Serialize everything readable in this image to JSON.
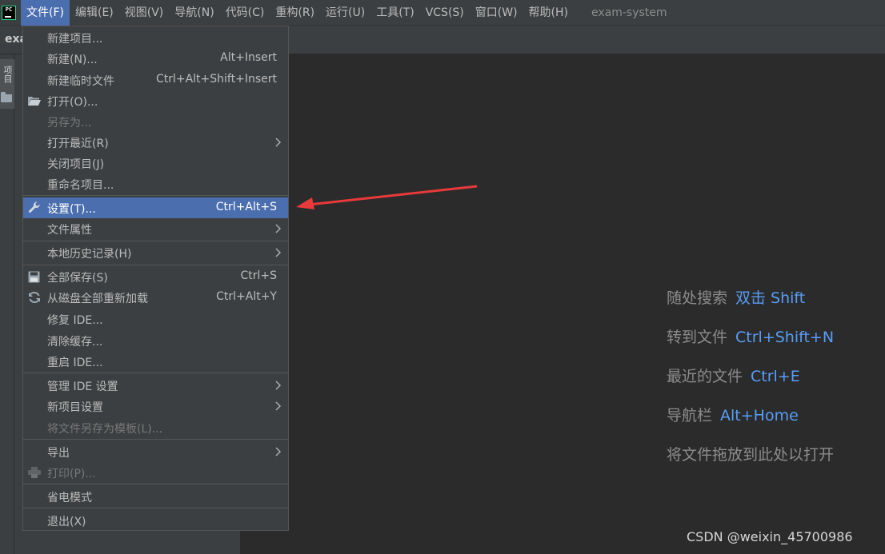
{
  "menubar": {
    "items": [
      {
        "label": "文件(F)",
        "active": true
      },
      {
        "label": "编辑(E)"
      },
      {
        "label": "视图(V)"
      },
      {
        "label": "导航(N)"
      },
      {
        "label": "代码(C)"
      },
      {
        "label": "重构(R)"
      },
      {
        "label": "运行(U)"
      },
      {
        "label": "工具(T)"
      },
      {
        "label": "VCS(S)"
      },
      {
        "label": "窗口(W)"
      },
      {
        "label": "帮助(H)"
      }
    ],
    "project_name": "exam-system",
    "app_icon_text": "PC"
  },
  "toolbar": {
    "breadcrumb": "exa"
  },
  "left_strip": {
    "tab_label": "项目"
  },
  "file_menu": {
    "items": [
      {
        "label": "新建项目...",
        "shortcut": ""
      },
      {
        "label": "新建(N)...",
        "shortcut": "Alt+Insert"
      },
      {
        "label": "新建临时文件",
        "shortcut": "Ctrl+Alt+Shift+Insert"
      },
      {
        "label": "打开(O)...",
        "shortcut": "",
        "icon": "folder-open-icon"
      },
      {
        "label": "另存为...",
        "shortcut": "",
        "disabled": true
      },
      {
        "label": "打开最近(R)",
        "shortcut": "",
        "submenu": true
      },
      {
        "label": "关闭项目(J)",
        "shortcut": ""
      },
      {
        "label": "重命名项目...",
        "shortcut": ""
      },
      {
        "label": "设置(T)...",
        "shortcut": "Ctrl+Alt+S",
        "icon": "wrench-icon",
        "selected": true
      },
      {
        "label": "文件属性",
        "shortcut": "",
        "submenu": true
      },
      {
        "label": "本地历史记录(H)",
        "shortcut": "",
        "submenu": true
      },
      {
        "label": "全部保存(S)",
        "shortcut": "Ctrl+S",
        "icon": "save-icon"
      },
      {
        "label": "从磁盘全部重新加载",
        "shortcut": "Ctrl+Alt+Y",
        "icon": "reload-icon"
      },
      {
        "label": "修复 IDE...",
        "shortcut": ""
      },
      {
        "label": "清除缓存...",
        "shortcut": ""
      },
      {
        "label": "重启 IDE...",
        "shortcut": ""
      },
      {
        "label": "管理 IDE 设置",
        "shortcut": "",
        "submenu": true
      },
      {
        "label": "新项目设置",
        "shortcut": "",
        "submenu": true
      },
      {
        "label": "将文件另存为模板(L)...",
        "shortcut": "",
        "disabled": true
      },
      {
        "label": "导出",
        "shortcut": "",
        "submenu": true
      },
      {
        "label": "打印(P)...",
        "shortcut": "",
        "icon": "print-icon",
        "disabled": true
      },
      {
        "label": "省电模式",
        "shortcut": ""
      },
      {
        "label": "退出(X)",
        "shortcut": ""
      }
    ]
  },
  "editor_hints": [
    {
      "label": "随处搜索",
      "key": "双击 Shift"
    },
    {
      "label": "转到文件",
      "key": "Ctrl+Shift+N"
    },
    {
      "label": "最近的文件",
      "key": "Ctrl+E"
    },
    {
      "label": "导航栏",
      "key": "Alt+Home"
    },
    {
      "label": "将文件拖放到此处以打开",
      "key": ""
    }
  ],
  "watermark": "CSDN @weixin_45700986",
  "colors": {
    "menubar_bg": "#3c3f41",
    "editor_bg": "#2b2b2b",
    "selection": "#4b6eaf",
    "hint_key": "#589df6",
    "arrow": "#e8393b"
  }
}
